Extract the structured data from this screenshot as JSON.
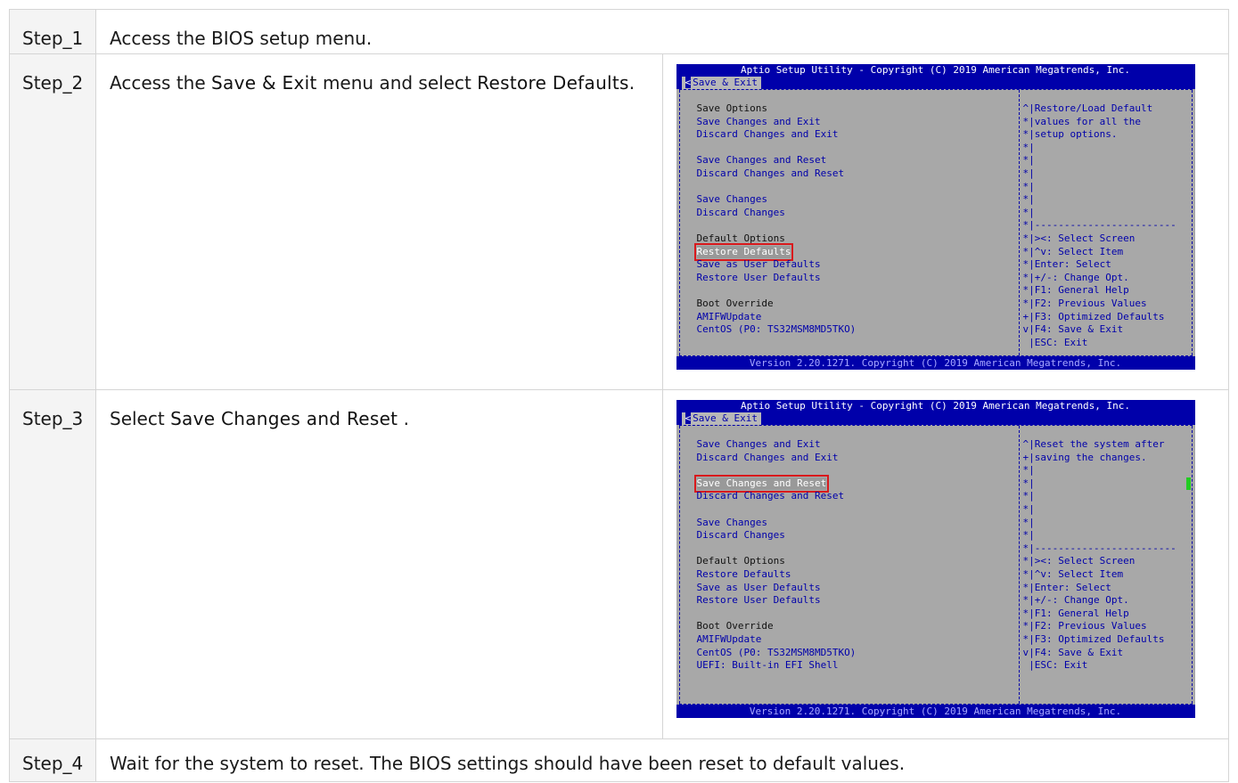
{
  "steps": [
    {
      "label": "Step_1",
      "text": "Access the BIOS setup menu."
    },
    {
      "label": "Step_2",
      "pre": "Access the ",
      "kw1": "Save & Exit",
      "mid": " menu and select ",
      "kw2": "Restore Defaults",
      "post": "."
    },
    {
      "label": "Step_3",
      "pre": "Select ",
      "kw1": "Save Changes and Reset",
      "post": " ."
    },
    {
      "label": "Step_4",
      "text": "Wait for the system to reset. The BIOS settings should have been reset to default values."
    }
  ],
  "bios": {
    "title": "Aptio Setup Utility - Copyright (C) 2019 American Megatrends, Inc.",
    "tab": "Save & Exit",
    "footer": "Version 2.20.1271. Copyright (C) 2019 American Megatrends, Inc.",
    "screen1": {
      "left": [
        {
          "t": "Save Options",
          "k": "hdr"
        },
        {
          "t": "Save Changes and Exit",
          "k": "opt"
        },
        {
          "t": "Discard Changes and Exit",
          "k": "opt"
        },
        {
          "t": "",
          "k": "blank"
        },
        {
          "t": "Save Changes and Reset",
          "k": "opt"
        },
        {
          "t": "Discard Changes and Reset",
          "k": "opt"
        },
        {
          "t": "",
          "k": "blank"
        },
        {
          "t": "Save Changes",
          "k": "opt"
        },
        {
          "t": "Discard Changes",
          "k": "opt"
        },
        {
          "t": "",
          "k": "blank"
        },
        {
          "t": "Default Options",
          "k": "hdr"
        },
        {
          "t": "Restore Defaults",
          "k": "sel"
        },
        {
          "t": "Save as User Defaults",
          "k": "opt"
        },
        {
          "t": "Restore User Defaults",
          "k": "opt"
        },
        {
          "t": "",
          "k": "blank"
        },
        {
          "t": "Boot Override",
          "k": "hdr"
        },
        {
          "t": "AMIFWUpdate",
          "k": "opt"
        },
        {
          "t": "CentOS (P0: TS32MSM8MD5TKO)",
          "k": "opt"
        }
      ],
      "right": [
        "^|Restore/Load Default",
        "*|values for all the",
        "*|setup options.",
        "*|",
        "*|",
        "*|",
        "*|",
        "*|",
        "*|",
        "*|------------------------",
        "*|><: Select Screen",
        "*|^v: Select Item",
        "*|Enter: Select",
        "*|+/-: Change Opt.",
        "*|F1: General Help",
        "*|F2: Previous Values",
        "+|F3: Optimized Defaults",
        "v|F4: Save & Exit",
        " |ESC: Exit"
      ]
    },
    "screen2": {
      "left": [
        {
          "t": "Save Changes and Exit",
          "k": "opt"
        },
        {
          "t": "Discard Changes and Exit",
          "k": "opt"
        },
        {
          "t": "",
          "k": "blank"
        },
        {
          "t": "Save Changes and Reset",
          "k": "sel"
        },
        {
          "t": "Discard Changes and Reset",
          "k": "opt"
        },
        {
          "t": "",
          "k": "blank"
        },
        {
          "t": "Save Changes",
          "k": "opt"
        },
        {
          "t": "Discard Changes",
          "k": "opt"
        },
        {
          "t": "",
          "k": "blank"
        },
        {
          "t": "Default Options",
          "k": "hdr"
        },
        {
          "t": "Restore Defaults",
          "k": "opt"
        },
        {
          "t": "Save as User Defaults",
          "k": "opt"
        },
        {
          "t": "Restore User Defaults",
          "k": "opt"
        },
        {
          "t": "",
          "k": "blank"
        },
        {
          "t": "Boot Override",
          "k": "hdr"
        },
        {
          "t": "AMIFWUpdate",
          "k": "opt"
        },
        {
          "t": "CentOS (P0: TS32MSM8MD5TKO)",
          "k": "opt"
        },
        {
          "t": "UEFI: Built-in EFI Shell",
          "k": "opt"
        }
      ],
      "right": [
        "^|Reset the system after",
        "+|saving the changes.",
        "*|",
        "*|",
        "*|",
        "*|",
        "*|",
        "*|",
        "*|------------------------",
        "*|><: Select Screen",
        "*|^v: Select Item",
        "*|Enter: Select",
        "*|+/-: Change Opt.",
        "*|F1: General Help",
        "*|F2: Previous Values",
        "*|F3: Optimized Defaults",
        "v|F4: Save & Exit",
        " |ESC: Exit"
      ]
    }
  }
}
